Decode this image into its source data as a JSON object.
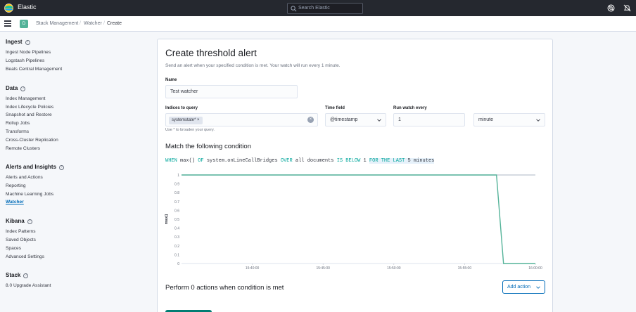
{
  "header": {
    "brand": "Elastic",
    "search_placeholder": "Search Elastic",
    "icons": [
      "elastic-logo-icon",
      "search-icon",
      "help-icon",
      "news-feed-icon"
    ]
  },
  "breadcrumbs": {
    "space_initial": "D",
    "items": [
      "Stack Management",
      "Watcher",
      "Create"
    ]
  },
  "sidebar": {
    "sections": [
      {
        "title": "Ingest",
        "items": [
          "Ingest Node Pipelines",
          "Logstash Pipelines",
          "Beats Central Management"
        ]
      },
      {
        "title": "Data",
        "items": [
          "Index Management",
          "Index Lifecycle Policies",
          "Snapshot and Restore",
          "Rollup Jobs",
          "Transforms",
          "Cross-Cluster Replication",
          "Remote Clusters"
        ]
      },
      {
        "title": "Alerts and Insights",
        "items": [
          "Alerts and Actions",
          "Reporting",
          "Machine Learning Jobs",
          "Watcher"
        ]
      },
      {
        "title": "Kibana",
        "items": [
          "Index Patterns",
          "Saved Objects",
          "Spaces",
          "Advanced Settings"
        ]
      },
      {
        "title": "Stack",
        "items": [
          "8.0 Upgrade Assistant"
        ]
      }
    ],
    "active_item": "Watcher"
  },
  "form": {
    "title": "Create threshold alert",
    "description": "Send an alert when your specified condition is met. Your watch will run every 1 minute.",
    "name_label": "Name",
    "name_value": "Test watcher",
    "indices_label": "Indices to query",
    "index_chip": "systemstate*",
    "indices_help": "Use * to broaden your query.",
    "time_field_label": "Time field",
    "time_field_value": "@timestamp",
    "run_every_label": "Run watch every",
    "run_every_value": "1",
    "run_every_unit": "minute"
  },
  "condition": {
    "heading": "Match the following condition",
    "when": "WHEN",
    "agg": "max()",
    "of": "OF",
    "field": "system.onLineCallBridges",
    "over": "OVER",
    "group": "all documents",
    "is": "IS BELOW",
    "threshold": "1",
    "for_the_last": "FOR THE LAST",
    "window_size": "5",
    "window_unit": "minutes"
  },
  "chart_data": {
    "type": "line",
    "ylabel": "max()",
    "xlabel": "",
    "x_ticks": [
      "15:40:00",
      "15:45:00",
      "15:50:00",
      "15:55:00",
      "16:00:00"
    ],
    "y_ticks": [
      1,
      0.9,
      0.8,
      0.7,
      0.6,
      0.5,
      0.4,
      0.3,
      0.2,
      0.1,
      0
    ],
    "ylim": [
      0,
      1
    ],
    "threshold_line": 1,
    "series": [
      {
        "color": "#54b399",
        "points": [
          [
            "15:35:00",
            1
          ],
          [
            "15:57:15",
            1
          ],
          [
            "15:57:45",
            0
          ],
          [
            "16:00:00",
            0
          ]
        ]
      }
    ]
  },
  "actions": {
    "heading": "Perform 0 actions when condition is met",
    "add_action_label": "Add action"
  }
}
